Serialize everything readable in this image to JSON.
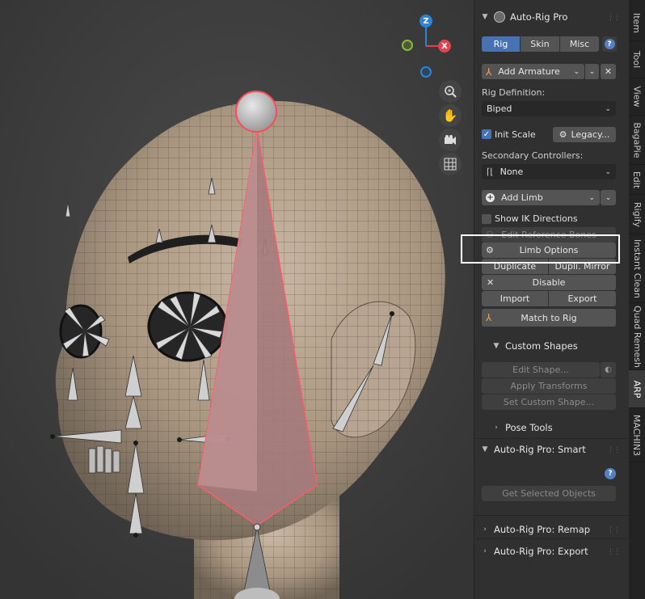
{
  "viewport": {
    "gizmo": {
      "z_label": "Z",
      "x_label": "X"
    }
  },
  "panel": {
    "title": "Auto-Rig Pro",
    "tabs": [
      "Rig",
      "Skin",
      "Misc"
    ],
    "help_symbol": "?",
    "add_armature": "Add Armature",
    "close_symbol": "✕",
    "rig_definition_label": "Rig Definition:",
    "rig_definition_value": "Biped",
    "init_scale_label": "Init Scale",
    "legacy_label": "Legacy...",
    "secondary_controllers_label": "Secondary Controllers:",
    "secondary_controllers_value": "None",
    "add_limb": "Add Limb",
    "show_ik_label": "Show IK Directions",
    "edit_reference_bones": "Edit Reference Bones",
    "limb_options": "Limb Options",
    "duplicate": "Duplicate",
    "dupli_mirror": "Dupli. Mirror",
    "disable": "Disable",
    "import": "Import",
    "export": "Export",
    "match_to_rig": "Match to Rig",
    "custom_shapes_title": "Custom Shapes",
    "edit_shape": "Edit Shape...",
    "apply_transforms": "Apply Transforms",
    "set_custom_shape": "Set Custom Shape...",
    "pose_tools_title": "Pose Tools",
    "smart_title": "Auto-Rig Pro: Smart",
    "get_selected_objects": "Get Selected Objects",
    "remap_title": "Auto-Rig Pro: Remap",
    "export_title": "Auto-Rig Pro: Export"
  },
  "side_tabs": [
    "Item",
    "Tool",
    "View",
    "BagaPie",
    "Edit",
    "Rigify",
    "Instant Clean",
    "Quad Remesh",
    "ARP",
    "MACHIN3"
  ],
  "active_side_tab": "ARP",
  "colors": {
    "accent_blue": "#4772b3",
    "axis_x": "#e0454f",
    "axis_y": "#8ab83a",
    "axis_z": "#2f83d6",
    "highlight": "#ffffff"
  }
}
